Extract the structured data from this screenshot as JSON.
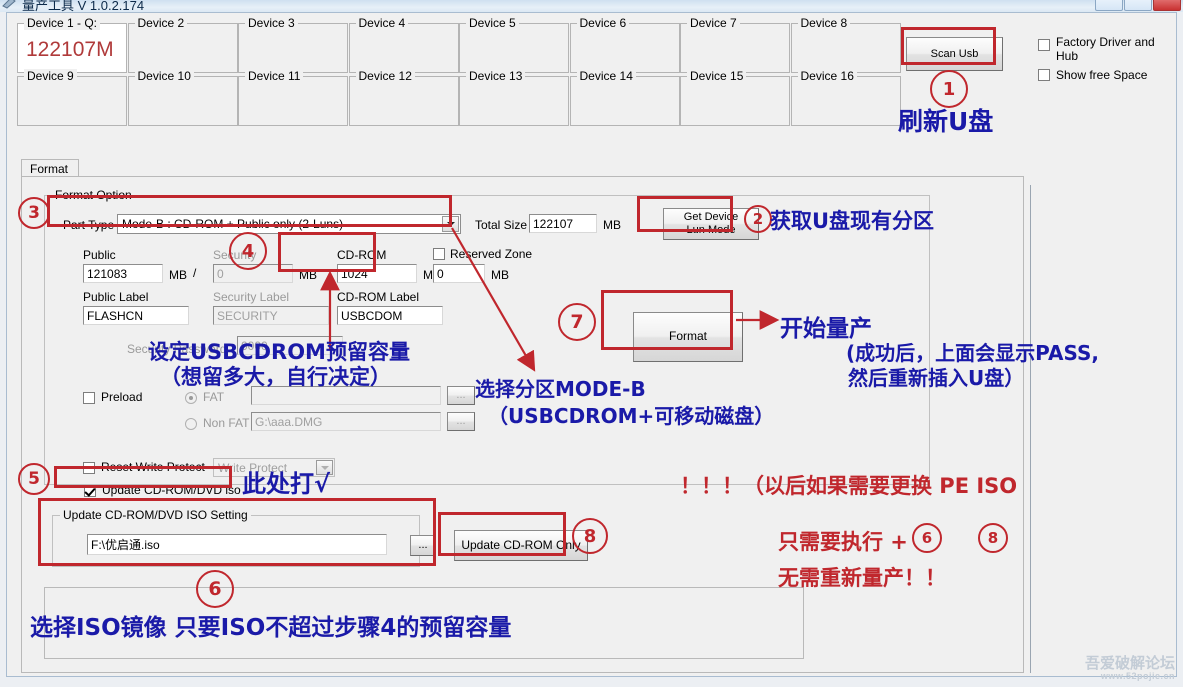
{
  "window": {
    "title": "量产工具 V 1.0.2.174",
    "minimize": "",
    "maximize": "",
    "close": ""
  },
  "devices": {
    "boxes": [
      {
        "label": "Device 1 - Q:",
        "value": "122107M"
      },
      {
        "label": "Device 2",
        "value": ""
      },
      {
        "label": "Device 3",
        "value": ""
      },
      {
        "label": "Device 4",
        "value": ""
      },
      {
        "label": "Device 5",
        "value": ""
      },
      {
        "label": "Device 6",
        "value": ""
      },
      {
        "label": "Device 7",
        "value": ""
      },
      {
        "label": "Device 8",
        "value": ""
      },
      {
        "label": "Device 9",
        "value": ""
      },
      {
        "label": "Device 10",
        "value": ""
      },
      {
        "label": "Device 11",
        "value": ""
      },
      {
        "label": "Device 12",
        "value": ""
      },
      {
        "label": "Device 13",
        "value": ""
      },
      {
        "label": "Device 14",
        "value": ""
      },
      {
        "label": "Device 15",
        "value": ""
      },
      {
        "label": "Device 16",
        "value": ""
      }
    ]
  },
  "toolbar": {
    "scan_usb": "Scan Usb",
    "factory_driver": "Factory Driver and Hub",
    "show_free_space": "Show free Space"
  },
  "tabs": [
    {
      "label": "Format",
      "selected": true
    }
  ],
  "format_option": {
    "group_label": "Format Option",
    "part_type_label": "Part Type",
    "part_type_value": "Mode-B : CD-ROM + Public only   (2-Luns)",
    "total_size_label": "Total Size",
    "total_size_value": "122107",
    "total_size_unit": "MB",
    "get_device_lun_mode": "Get Device Lun Mode",
    "public_label": "Public",
    "public_value": "121083",
    "public_unit": "MB",
    "public_slash": "/",
    "security_label": "Security",
    "security_value": "0",
    "security_unit": "MB",
    "cdrom_label": "CD-ROM",
    "cdrom_value": "1024",
    "cdrom_unit": "MB",
    "reserved_zone_label": "Reserved Zone",
    "reserved_zone_value": "0",
    "reserved_zone_unit": "MB",
    "public_label_label": "Public Label",
    "public_label_value": "FLASHCN",
    "security_label_label": "Security Label",
    "security_label_value": "SECURITY",
    "cdrom_label_label": "CD-ROM Label",
    "cdrom_label_value": "USBCDOM",
    "security_password_label": "Security Password",
    "security_password_value": "0000",
    "preload_label": "Preload",
    "fat_label": "FAT",
    "non_fat_label": "Non FAT",
    "fat_path": "",
    "non_fat_path": "G:\\aaa.DMG",
    "browse_label": "...",
    "reset_write_protect_label": "Reset Write Protect",
    "write_protect_value": "Write Protect",
    "update_cdrom_dvd_iso_label": "Update CD-ROM/DVD iso",
    "format_button": "Format"
  },
  "iso_setting": {
    "group_label": "Update CD-ROM/DVD ISO Setting",
    "path_value": "F:\\优启通.iso",
    "browse_label": "...",
    "update_cdrom_only": "Update CD-ROM Only"
  },
  "annotations": {
    "n1": "1",
    "n2": "2",
    "n3": "3",
    "n4": "4",
    "n5": "5",
    "n6": "6",
    "n7": "7",
    "n8": "8",
    "t1": "刷新U盘",
    "t2": "获取U盘现有分区",
    "t4_line1": "设定USBCDROM预留容量",
    "t4_line2": "（想留多大，自行决定）",
    "t3_line1": "选择分区MODE-B",
    "t3_line2": "（USBCDROM+可移动磁盘）",
    "t7_line1": "开始量产",
    "t7_line2": "(成功后，上面会显示PASS,",
    "t7_line3": "然后重新插入U盘）",
    "t5": "此处打√",
    "t6": "选择ISO镜像 只要ISO不超过步骤4的预留容量",
    "t8_line1": "！！！（以后如果需要更换 PE ISO",
    "t8_line2": "只需要执行     +",
    "t8_line3": "无需重新量产！！",
    "t8_inline_a": "6",
    "t8_inline_b": "8"
  },
  "watermark": {
    "line1": "吾爱破解论坛",
    "line2": "www.52pojie.cn"
  }
}
